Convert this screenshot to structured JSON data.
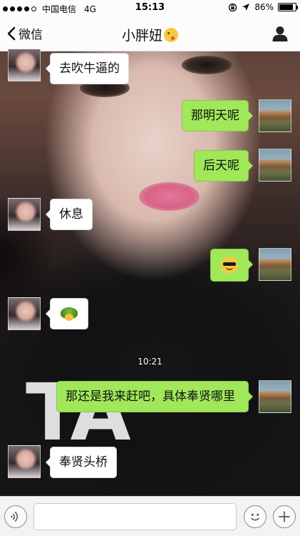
{
  "status_bar": {
    "signal_dots": 5,
    "signal_filled": 4,
    "carrier": "中国电信",
    "network": "4G",
    "time": "15:13",
    "battery_text": "86%",
    "battery_level": 0.86
  },
  "nav": {
    "back_label": "微信",
    "chat_title": "小胖妞",
    "title_emoji": "kiss-face-icon",
    "profile_icon": "person-icon"
  },
  "messages": [
    {
      "side": "left",
      "type": "text",
      "text": "去吹牛逼的"
    },
    {
      "side": "right",
      "type": "text",
      "text": "那明天呢"
    },
    {
      "side": "right",
      "type": "text",
      "text": "后天呢"
    },
    {
      "side": "left",
      "type": "text",
      "text": "休息"
    },
    {
      "side": "right",
      "type": "emoji",
      "emoji": "sunglasses-smiley-icon"
    },
    {
      "side": "left",
      "type": "emoji",
      "emoji": "turtle-icon"
    },
    {
      "type": "timestamp",
      "text": "10:21"
    },
    {
      "side": "right",
      "type": "text",
      "text": "那还是我来赶吧，具体奉贤哪里"
    },
    {
      "side": "left",
      "type": "text",
      "text": "奉贤头桥"
    }
  ],
  "wallpaper_text": "TA",
  "input_bar": {
    "voice_icon": "voice-icon",
    "text_value": "",
    "emoji_icon": "smiley-icon",
    "more_icon": "plus-icon"
  },
  "colors": {
    "outgoing_bubble": "#a0e75a",
    "incoming_bubble": "#ffffff"
  }
}
